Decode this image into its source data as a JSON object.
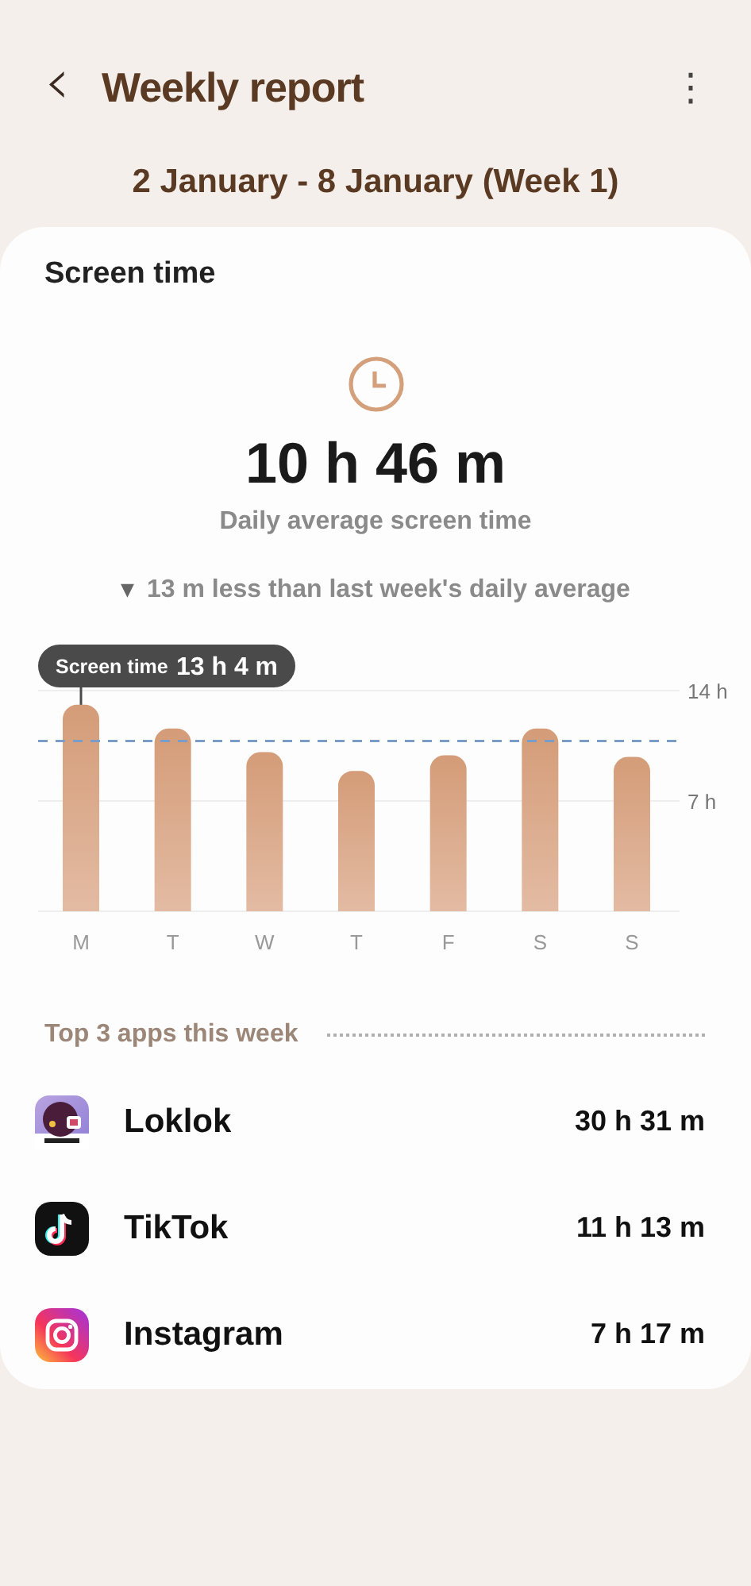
{
  "header": {
    "back": "‹",
    "title": "Weekly report",
    "menu": "⋮"
  },
  "date_range": "2 January - 8 January (Week 1)",
  "screen_time": {
    "heading": "Screen time",
    "total": "10 h 46 m",
    "caption": "Daily average screen time",
    "trend_marker": "▼",
    "comparison": "13 m less than last week's daily average",
    "tooltip": {
      "label": "Screen time",
      "value": "13 h 4 m"
    },
    "chart_data": {
      "type": "bar",
      "categories": [
        "M",
        "T",
        "W",
        "T",
        "F",
        "S",
        "S"
      ],
      "values": [
        13.1,
        11.6,
        10.1,
        8.9,
        9.9,
        11.6,
        9.8
      ],
      "ylim": [
        0,
        14
      ],
      "yticks": [
        {
          "value": 7,
          "label": "7 h"
        },
        {
          "value": 14,
          "label": "14 h"
        }
      ],
      "ref_lines": [
        {
          "axis": "y",
          "value": 10.8
        }
      ]
    }
  },
  "top_apps": {
    "heading": "Top 3 apps this week",
    "apps": [
      {
        "name": "Loklok",
        "time": "30 h 31 m",
        "kind": "loklok"
      },
      {
        "name": "TikTok",
        "time": "11 h 13 m",
        "kind": "tiktok"
      },
      {
        "name": "Instagram",
        "time": "7 h 17 m",
        "kind": "instagram"
      }
    ]
  }
}
